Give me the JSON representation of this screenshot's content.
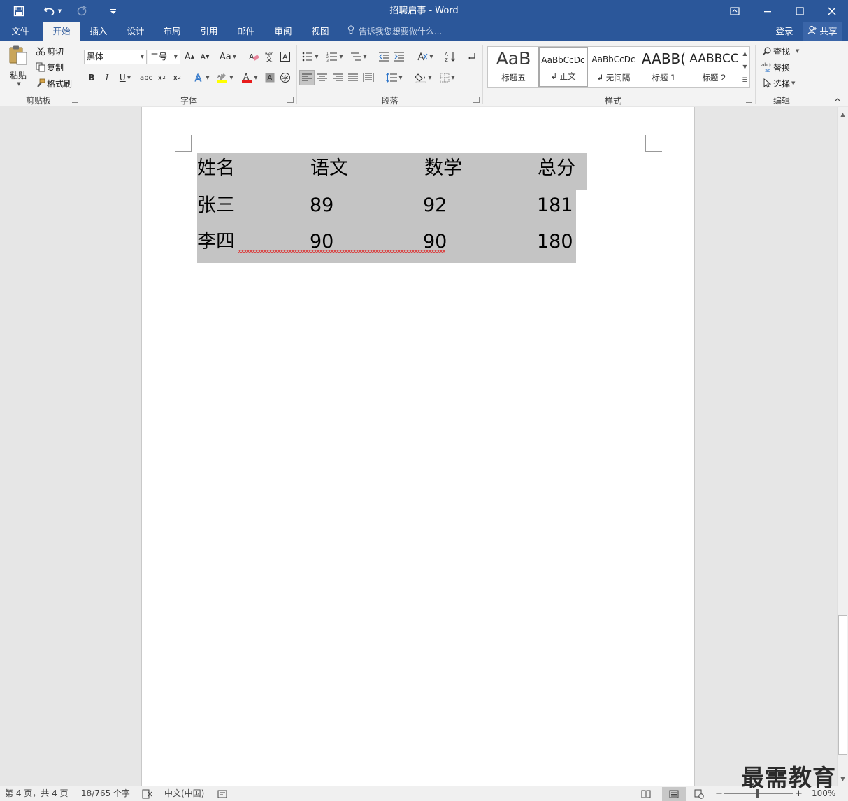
{
  "window": {
    "title": "招聘启事 - Word"
  },
  "quick_access": {
    "save_icon": "save-icon",
    "undo_icon": "undo-icon",
    "redo_icon": "redo-icon",
    "customize_icon": "customize-icon"
  },
  "tabs": [
    {
      "label": "文件"
    },
    {
      "label": "开始"
    },
    {
      "label": "插入"
    },
    {
      "label": "设计"
    },
    {
      "label": "布局"
    },
    {
      "label": "引用"
    },
    {
      "label": "邮件"
    },
    {
      "label": "审阅"
    },
    {
      "label": "视图"
    }
  ],
  "tell_me": {
    "placeholder": "告诉我您想要做什么..."
  },
  "account": {
    "login": "登录",
    "share": "共享"
  },
  "clipboard": {
    "paste": "粘贴",
    "cut": "剪切",
    "copy": "复制",
    "format_painter": "格式刷",
    "group_label": "剪贴板"
  },
  "font": {
    "family": "黑体",
    "size": "二号",
    "case_button": "Aa",
    "group_label": "字体"
  },
  "paragraph": {
    "group_label": "段落"
  },
  "styles": {
    "items": [
      {
        "sample": "AaB",
        "name": "标题五"
      },
      {
        "sample": "AaBbCcDc",
        "name": "↲ 正文"
      },
      {
        "sample": "AaBbCcDc",
        "name": "↲ 无间隔"
      },
      {
        "sample": "AABB(",
        "name": "标题 1"
      },
      {
        "sample": "AABBCC",
        "name": "标题 2"
      }
    ],
    "group_label": "样式"
  },
  "editing": {
    "find": "查找",
    "replace": "替换",
    "select": "选择",
    "group_label": "编辑"
  },
  "document": {
    "table": {
      "headers": [
        "姓名",
        "语文",
        "数学",
        "总分"
      ],
      "rows": [
        [
          "张三",
          "89",
          "92",
          "181"
        ],
        [
          "李四",
          "90",
          "90",
          "180"
        ]
      ]
    }
  },
  "status": {
    "page": "第 4 页，共 4 页",
    "words": "18/765 个字",
    "language": "中文(中国)",
    "zoom": "100%"
  },
  "watermark": "最需教育"
}
